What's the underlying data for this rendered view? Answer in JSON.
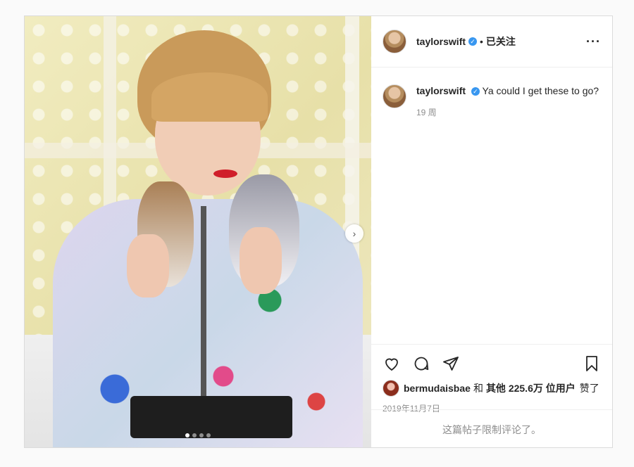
{
  "post": {
    "author": {
      "username": "taylorswift",
      "follow_status": "已关注"
    },
    "caption": {
      "username": "taylorswift",
      "text": "Ya could I get these to go?",
      "time_ago": "19 周"
    },
    "likes": {
      "liked_by": "bermudaisbae",
      "conjunction": "和",
      "others_label": "其他",
      "count": "225.6万",
      "suffix": "位用户",
      "verb": "赞了"
    },
    "date": "2019年11月7日",
    "comments_disabled": "这篇帖子限制评论了。",
    "carousel": {
      "total_slides": 4,
      "active_index": 0
    },
    "icons": {
      "more": "more-options-icon",
      "like": "heart-icon",
      "comment": "comment-icon",
      "share": "send-icon",
      "save": "bookmark-icon",
      "next": "chevron-right-icon",
      "verified": "verified-badge-icon"
    },
    "colors": {
      "verified": "#3897f0",
      "muted_text": "#8e8e8e"
    }
  }
}
